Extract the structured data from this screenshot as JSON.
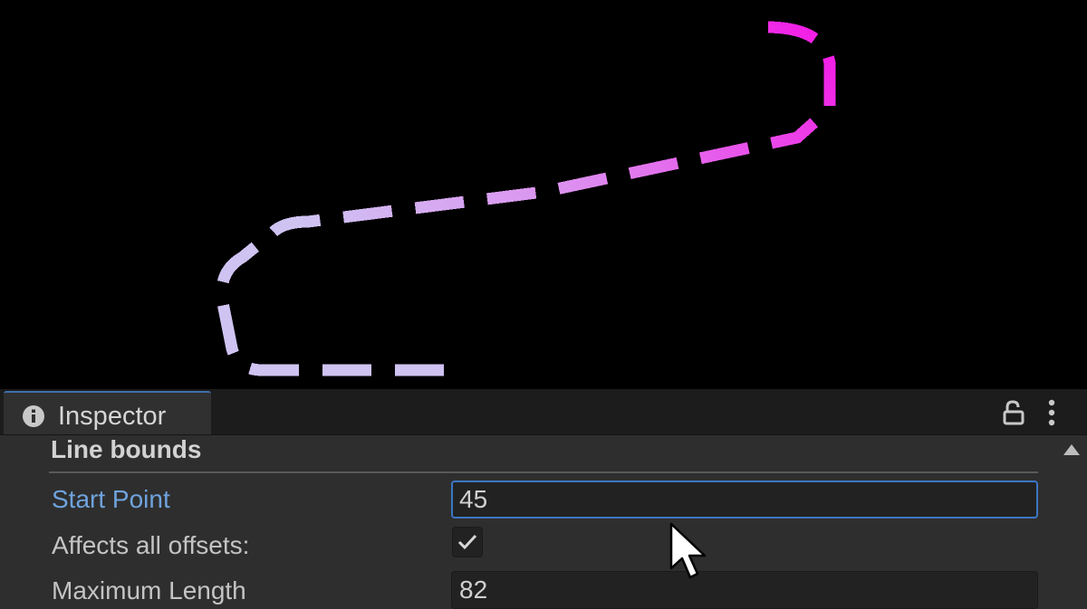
{
  "inspector": {
    "tab_title": "Inspector",
    "tab_icon": "info-icon",
    "lock_icon": "lock-icon",
    "menu_icon": "kebab-menu-icon",
    "scroll_up_icon": "scroll-up-arrow-icon",
    "section_header": "Line bounds",
    "start_point": {
      "label": "Start Point",
      "value": "45"
    },
    "affects_all_offsets": {
      "label": "Affects all offsets:",
      "checked": true,
      "check_icon": "checkmark-icon"
    },
    "maximum_length": {
      "label": "Maximum Length",
      "value": "82"
    }
  },
  "scene": {
    "background": "#000000",
    "line_style": "dashed",
    "gradient_start_color": "#cfc3f2",
    "gradient_end_color": "#f21fe6"
  },
  "colors": {
    "focus_accent": "#3c77c4",
    "focused_label": "#6fa3dd",
    "panel_background": "#2e2e2e"
  },
  "cursor_icon": "mouse-pointer-icon"
}
